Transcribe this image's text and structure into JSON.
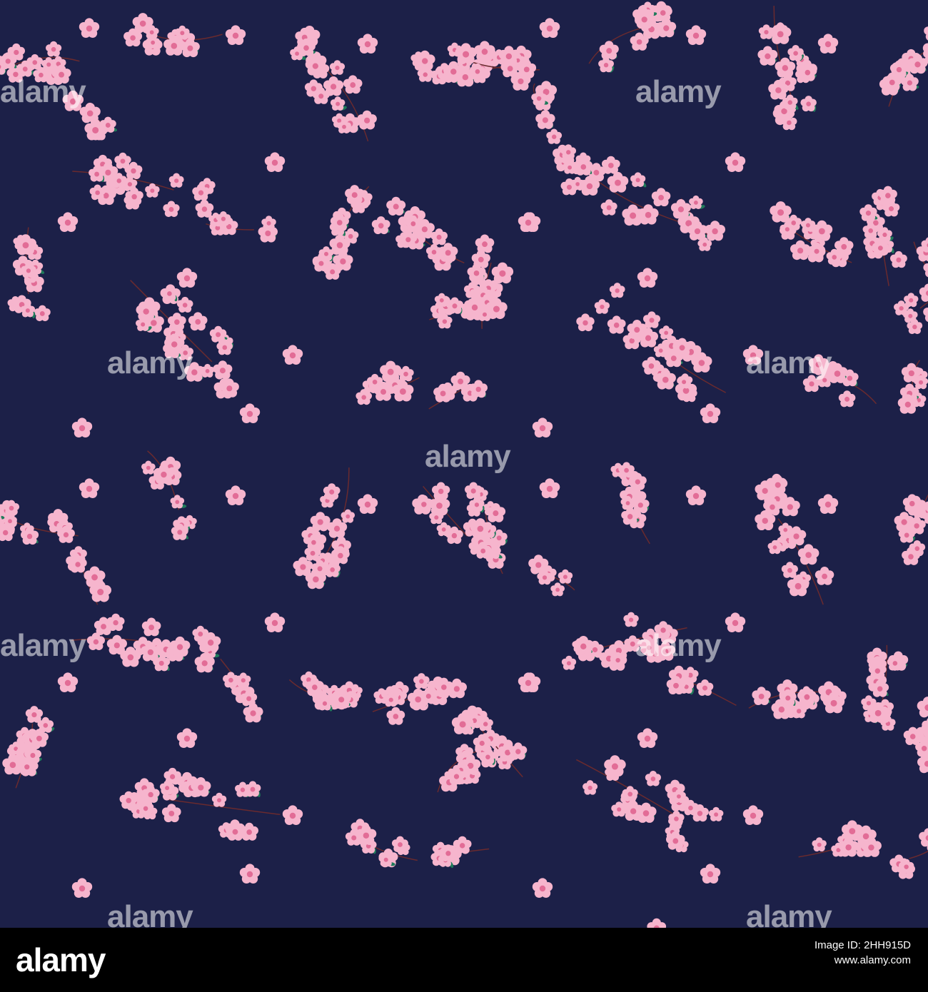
{
  "image": {
    "background_color": "#1c2048",
    "blossom_color": "#f6b5cd",
    "blossom_center_color": "#e26c96",
    "leaf_color": "#1f7a5a",
    "branch_color": "#6a2a2e",
    "subject": "cherry-blossom-seamless-pattern"
  },
  "watermark": {
    "text": "alamy"
  },
  "footer": {
    "logo": "alamy",
    "line1": "Image ID: 2HH915D",
    "line2": "www.alamy.com"
  }
}
